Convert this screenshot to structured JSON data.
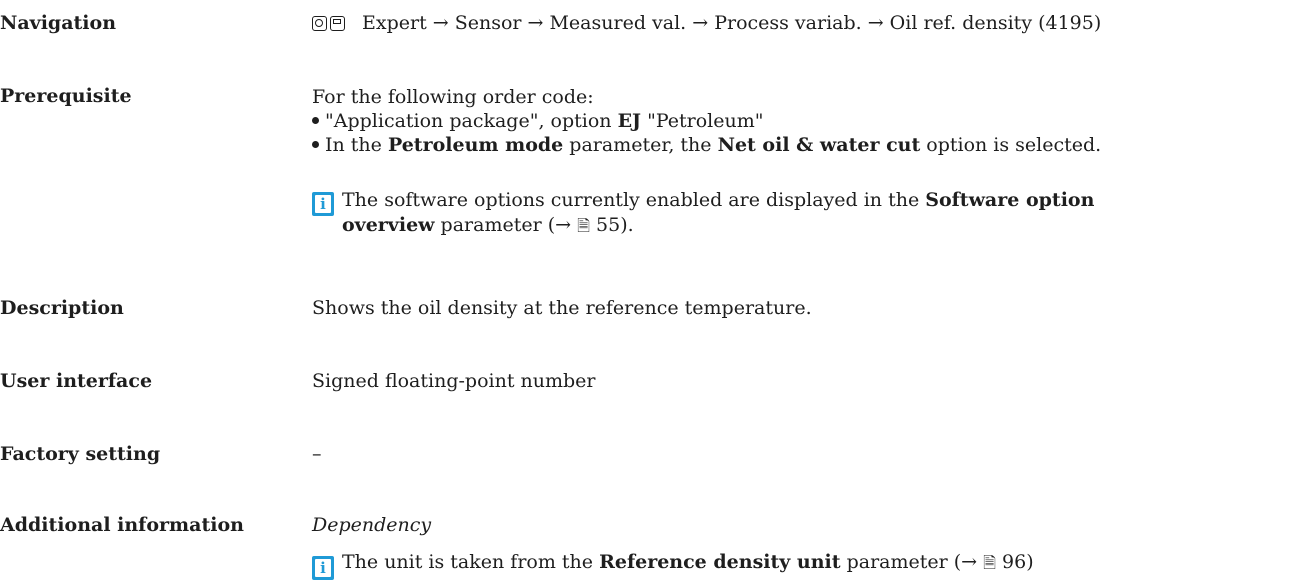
{
  "navigation": {
    "label": "Navigation",
    "icon_names": [
      "display-icon",
      "operating-tool-icon"
    ],
    "path": "Expert → Sensor → Measured val. → Process variab. → Oil ref. density (4195)"
  },
  "prerequisite": {
    "label": "Prerequisite",
    "intro": "For the following order code:",
    "items": [
      {
        "pre": "\"Application package\", option ",
        "bold": "EJ",
        "post": " \"Petroleum\""
      },
      {
        "pre": "In the ",
        "bold": "Petroleum mode",
        "mid": " parameter, the ",
        "bold2": "Net oil & water cut",
        "post": " option is selected."
      }
    ],
    "note": {
      "icon": "info-icon",
      "line1_pre": "The software options currently enabled are displayed in the ",
      "line1_bold": "Software option",
      "line2_bold": "overview",
      "line2_post": " parameter (→ ",
      "page_icon": "book-icon",
      "page_ref": "55",
      "tail": ")."
    }
  },
  "description": {
    "label": "Description",
    "text": "Shows the oil density at the reference temperature."
  },
  "user_interface": {
    "label": "User interface",
    "text": "Signed floating-point number"
  },
  "factory_setting": {
    "label": "Factory setting",
    "text": "–"
  },
  "additional_information": {
    "label": "Additional information",
    "subheading": "Dependency",
    "note": {
      "icon": "info-icon",
      "pre": "The unit is taken from the ",
      "bold": "Reference density unit",
      "post": " parameter (→ ",
      "page_icon": "book-icon",
      "page_ref": "96",
      "tail": ")"
    }
  }
}
